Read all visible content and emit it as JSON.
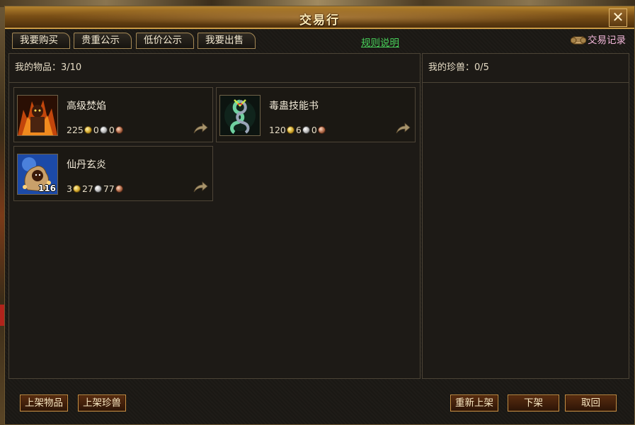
{
  "window": {
    "title": "交易行",
    "close_label": "✕"
  },
  "tabs": [
    {
      "label": "我要购买"
    },
    {
      "label": "贵重公示"
    },
    {
      "label": "低价公示"
    },
    {
      "label": "我要出售"
    }
  ],
  "rules_link": "规则说明",
  "trade_log": "交易记录",
  "left_panel": {
    "header": "我的物品：3/10"
  },
  "right_panel": {
    "header": "我的珍兽：0/5"
  },
  "items": [
    {
      "name": "高级焚焰",
      "gold": "225",
      "silver": "0",
      "copper": "0",
      "icon": "fire-demon-icon"
    },
    {
      "name": "毒蛊技能书",
      "gold": "120",
      "silver": "6",
      "copper": "0",
      "icon": "serpent-skillbook-icon"
    },
    {
      "name": "仙丹玄炎",
      "gold": "3",
      "silver": "27",
      "copper": "77",
      "icon": "elixir-sack-icon",
      "quantity": "116"
    }
  ],
  "buttons": {
    "list_item": "上架物品",
    "list_pet": "上架珍兽",
    "relist": "重新上架",
    "delist": "下架",
    "cancel": "取回"
  },
  "colors": {
    "title_gold": "#fbe9b6",
    "link_green": "#48d05a",
    "trade_log_pink": "#f2b6d9",
    "button_border": "#c78f44"
  }
}
